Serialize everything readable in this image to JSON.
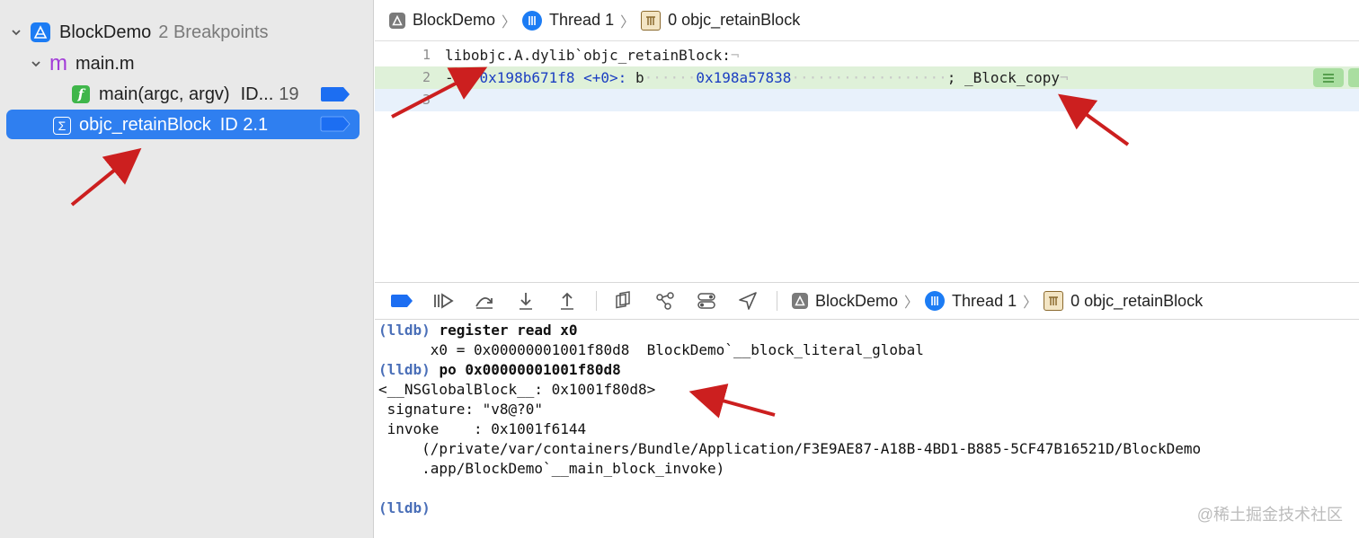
{
  "sidebar": {
    "project": {
      "name": "BlockDemo",
      "breakpoint_count": "2 Breakpoints"
    },
    "file": {
      "name": "main.m",
      "icon": "m"
    },
    "breakpoints": [
      {
        "label": "main(argc, argv)",
        "id": "ID...",
        "line": "19"
      },
      {
        "label": "objc_retainBlock",
        "id": "ID 2.1"
      }
    ],
    "colors": {
      "selection": "#2f7ff0",
      "badge": "#1c6ef2"
    }
  },
  "top_breadcrumb": {
    "project": "BlockDemo",
    "thread": "Thread 1",
    "frame": "0 objc_retainBlock"
  },
  "disassembly": {
    "lines": [
      {
        "number": "1",
        "text": "libobjc.A.dylib`objc_retainBlock:"
      },
      {
        "number": "2",
        "arrow": "->",
        "address": "0x198b671f8",
        "offset": "<+0>:",
        "mnemonic": "b",
        "target": "0x198a57838",
        "comment": "; _Block_copy"
      },
      {
        "number": "3",
        "text": ""
      }
    ],
    "pilcrow": "¬"
  },
  "debug_bar": {
    "icons": [
      "breakpoint-toggle-icon",
      "continue-icon",
      "step-over-icon",
      "step-into-icon",
      "step-out-icon",
      "view-hierarchy-icon",
      "memory-graph-icon",
      "environment-overrides-icon",
      "simulate-location-icon"
    ],
    "breadcrumb": {
      "project": "BlockDemo",
      "thread": "Thread 1",
      "frame": "0 objc_retainBlock"
    }
  },
  "console": {
    "prompt": "(lldb)",
    "lines": [
      {
        "type": "cmd",
        "text": "register read x0"
      },
      {
        "type": "out",
        "text": "      x0 = 0x00000001001f80d8  BlockDemo`__block_literal_global"
      },
      {
        "type": "cmd",
        "text": "po 0x00000001001f80d8"
      },
      {
        "type": "out",
        "text": "<__NSGlobalBlock__: 0x1001f80d8>"
      },
      {
        "type": "out",
        "text": " signature: \"v8@?0\""
      },
      {
        "type": "out",
        "text": " invoke    : 0x1001f6144"
      },
      {
        "type": "out",
        "text": "     (/private/var/containers/Bundle/Application/F3E9AE87-A18B-4BD1-B885-5CF47B16521D/BlockDemo"
      },
      {
        "type": "out",
        "text": "     .app/BlockDemo`__main_block_invoke)"
      },
      {
        "type": "out",
        "text": ""
      },
      {
        "type": "prompt",
        "text": ""
      }
    ]
  },
  "watermark": "@稀土掘金技术社区"
}
